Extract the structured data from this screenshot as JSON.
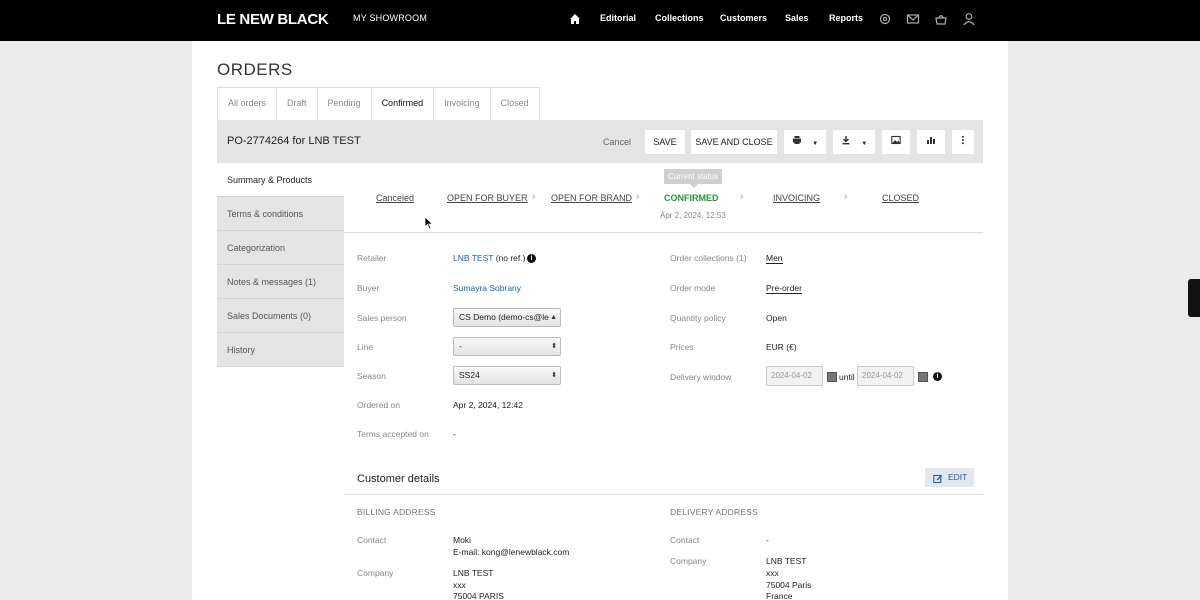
{
  "nav": {
    "brand": "LE NEW BLACK",
    "showroom": "MY SHOWROOM",
    "links": [
      "Editorial",
      "Collections",
      "Customers",
      "Sales",
      "Reports"
    ],
    "icons": [
      "home-icon",
      "settings-icon",
      "mail-icon",
      "basket-icon",
      "user-icon"
    ]
  },
  "page_title": "ORDERS",
  "tabs": [
    "All orders",
    "Draft",
    "Pending",
    "Confirmed",
    "Invoicing",
    "Closed"
  ],
  "active_tab": "Confirmed",
  "order": {
    "title": "PO-2774264 for LNB TEST",
    "cancel": "Cancel",
    "save": "SAVE",
    "save_close": "SAVE AND CLOSE"
  },
  "sidebar": [
    "Summary & Products",
    "Terms & conditions",
    "Categorization",
    "Notes & messages (1)",
    "Sales Documents (0)",
    "History"
  ],
  "status_flow": {
    "steps": [
      "Canceled",
      "OPEN FOR BUYER",
      "OPEN FOR BRAND",
      "CONFIRMED",
      "INVOICING",
      "CLOSED"
    ],
    "current": "CONFIRMED",
    "tooltip": "Current status",
    "current_date": "Apr 2, 2024, 12:53"
  },
  "details": {
    "retailer_label": "Retailer",
    "retailer": "LNB TEST",
    "retailer_ref": "(no ref.)",
    "buyer_label": "Buyer",
    "buyer": "Sumayra Sobrany",
    "sales_person_label": "Sales person",
    "sales_person": "CS Demo (demo-cs@le",
    "line_label": "Line",
    "line": "-",
    "season_label": "Season",
    "season": "SS24",
    "ordered_on_label": "Ordered on",
    "ordered_on": "Apr 2, 2024, 12:42",
    "terms_label": "Terms accepted on",
    "terms": "-",
    "order_collections_label": "Order collections (1)",
    "order_collections": "Men",
    "order_mode_label": "Order mode",
    "order_mode": "Pre-order",
    "quantity_policy_label": "Quantity policy",
    "quantity_policy": "Open",
    "prices_label": "Prices",
    "prices": "EUR (€)",
    "delivery_window_label": "Delivery window",
    "delivery_from": "2024-04-02",
    "delivery_until_label": "until",
    "delivery_to": "2024-04-02"
  },
  "customer": {
    "title": "Customer details",
    "edit": "EDIT",
    "billing_caption": "BILLING ADDRESS",
    "delivery_caption": "DELIVERY ADDRESS",
    "contact_label": "Contact",
    "company_label": "Company",
    "billing_contact": "Moki",
    "billing_email": "E-mail: kong@lenewblack.com",
    "billing_company": "LNB TEST",
    "billing_line2": "xxx",
    "billing_line3": "75004 PARIS",
    "delivery_contact": "-",
    "delivery_company": "LNB TEST",
    "delivery_line2": "xxx",
    "delivery_line3": "75004 Paris",
    "delivery_line4": "France"
  },
  "colors": {
    "topbar": "#000000",
    "confirmed_green": "#1f9a3c",
    "link_blue": "#1e5fbf",
    "edit_blue": "#2d5e9c"
  }
}
